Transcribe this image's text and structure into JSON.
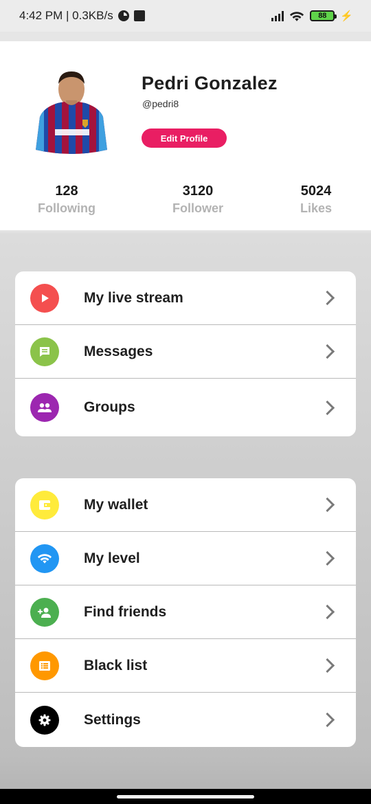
{
  "status_bar": {
    "time_speed": "4:42 PM | 0.3KB/s",
    "battery": "88",
    "icons": [
      "data-usage-icon",
      "square-notification-icon",
      "signal-bars-icon",
      "wifi-icon",
      "battery-icon",
      "charging-bolt-icon"
    ]
  },
  "profile": {
    "name": "Pedri Gonzalez",
    "handle": "@pedri8",
    "edit_label": "Edit Profile",
    "accent_color": "#e91e63",
    "stats": [
      {
        "value": "128",
        "label": "Following"
      },
      {
        "value": "3120",
        "label": "Follower"
      },
      {
        "value": "5024",
        "label": "Likes"
      }
    ]
  },
  "menu_groups": [
    {
      "items": [
        {
          "label": "My live stream",
          "icon": "play-icon",
          "color": "#f44f4f"
        },
        {
          "label": "Messages",
          "icon": "message-icon",
          "color": "#8bc34a"
        },
        {
          "label": "Groups",
          "icon": "group-icon",
          "color": "#9c27b0"
        }
      ]
    },
    {
      "items": [
        {
          "label": "My wallet",
          "icon": "wallet-icon",
          "color": "#ffeb3b"
        },
        {
          "label": "My level",
          "icon": "wifi-icon",
          "color": "#2196f3"
        },
        {
          "label": "Find friends",
          "icon": "add-person-icon",
          "color": "#4caf50"
        },
        {
          "label": "Black list",
          "icon": "list-icon",
          "color": "#ff9800"
        },
        {
          "label": "Settings",
          "icon": "gear-icon",
          "color": "#000000"
        }
      ]
    }
  ]
}
